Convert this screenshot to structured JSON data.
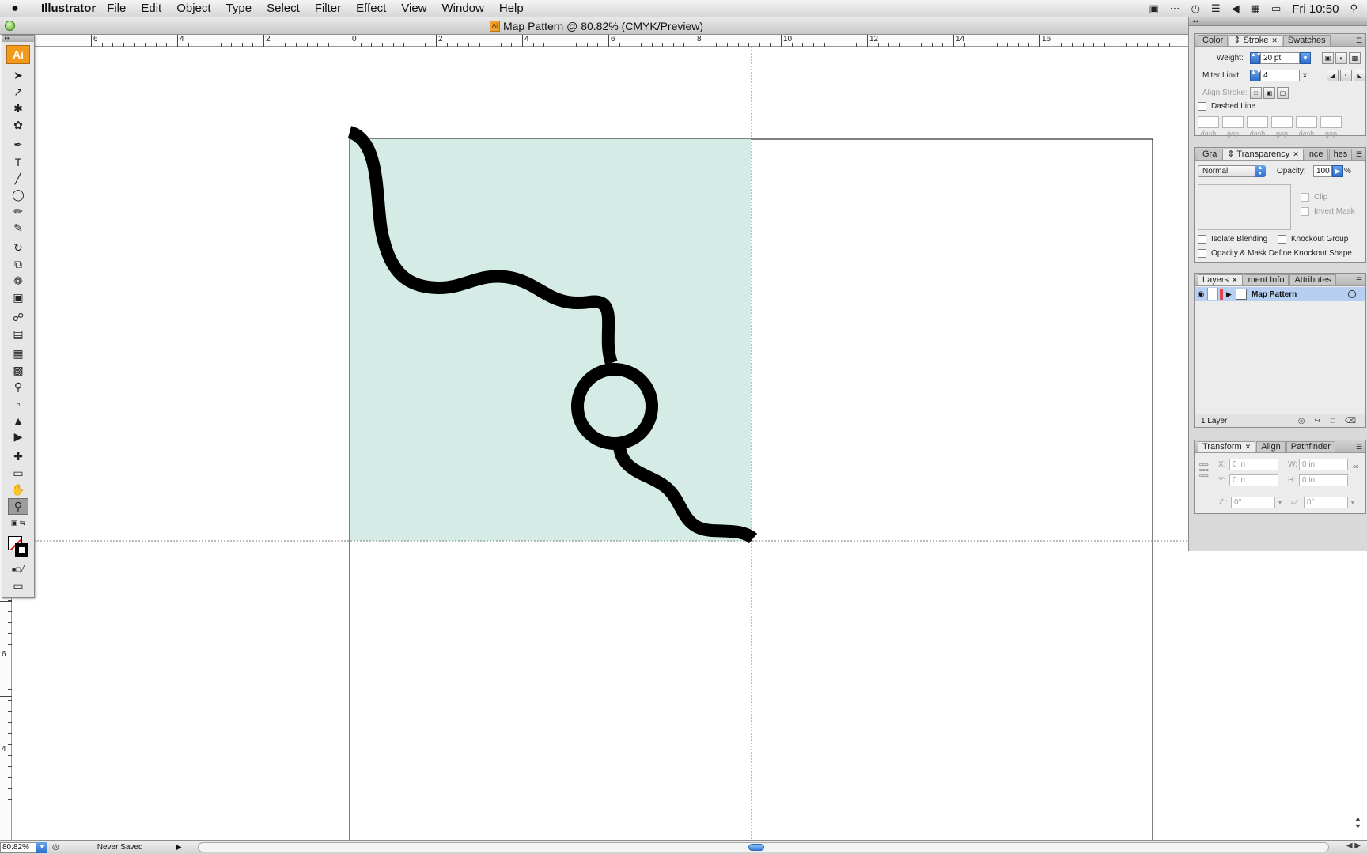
{
  "menubar": {
    "apple": "",
    "app_name": "Illustrator",
    "items": [
      "File",
      "Edit",
      "Object",
      "Type",
      "Select",
      "Filter",
      "Effect",
      "View",
      "Window",
      "Help"
    ],
    "clock": "Fri 10:50"
  },
  "document": {
    "title": "Map Pattern @ 80.82% (CMYK/Preview)",
    "doc_icon": "Ai"
  },
  "rulers": {
    "top_labels": [
      "6",
      "4",
      "2",
      "0",
      "2",
      "4",
      "6",
      "8",
      "10",
      "12",
      "14",
      "16"
    ],
    "left_labels": [
      "6",
      "4"
    ]
  },
  "toolbox": {
    "logo": "Ai"
  },
  "canvas": {
    "tile_fill": "#d5ece6",
    "stroke_color": "#000000"
  },
  "stroke_panel": {
    "tabs": [
      "Color",
      "Stroke",
      "Swatches"
    ],
    "weight_label": "Weight:",
    "weight_value": "20 pt",
    "miter_label": "Miter Limit:",
    "miter_value": "4",
    "miter_unit": "x",
    "align_label": "Align Stroke:",
    "dashed_label": "Dashed Line",
    "dash_labels": [
      "dash",
      "gap",
      "dash",
      "gap",
      "dash",
      "gap"
    ]
  },
  "transparency_panel": {
    "tabs": [
      "Gra",
      "Transparency",
      "nce",
      "hes"
    ],
    "blend_mode": "Normal",
    "opacity_label": "Opacity:",
    "opacity_value": "100",
    "opacity_unit": "%",
    "clip_label": "Clip",
    "invert_label": "Invert Mask",
    "isolate_label": "Isolate Blending",
    "knockout_label": "Knockout Group",
    "opacity_mask_label": "Opacity & Mask Define Knockout Shape"
  },
  "layers_panel": {
    "tabs": [
      "Layers",
      "ment Info",
      "Attributes"
    ],
    "layer_name": "Map Pattern",
    "footer": "1 Layer"
  },
  "transform_panel": {
    "tabs": [
      "Transform",
      "Align",
      "Pathfinder"
    ],
    "x_label": "X:",
    "x_value": "0 in",
    "y_label": "Y:",
    "y_value": "0 in",
    "w_label": "W:",
    "w_value": "0 in",
    "h_label": "H:",
    "h_value": "0 in",
    "rotate_value": "0°",
    "shear_value": "0°"
  },
  "statusbar": {
    "zoom": "80.82%",
    "status": "Never Saved"
  }
}
